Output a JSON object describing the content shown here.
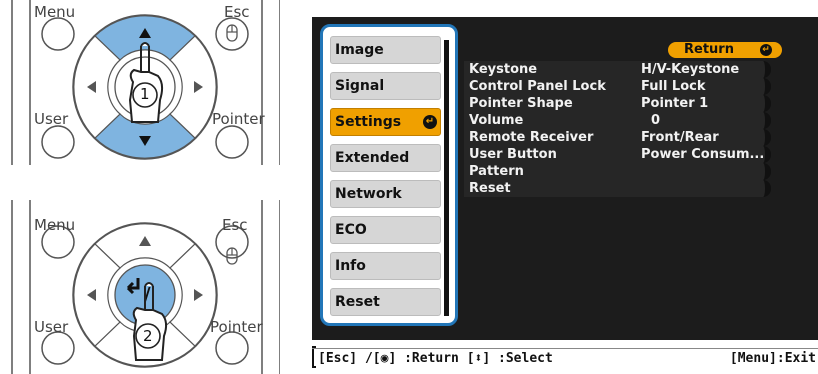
{
  "remote_top": {
    "menu_label": "Menu",
    "esc_label": "Esc",
    "user_label": "User",
    "pointer_label": "Pointer",
    "step": "1"
  },
  "remote_bottom": {
    "menu_label": "Menu",
    "esc_label": "Esc",
    "user_label": "User",
    "pointer_label": "Pointer",
    "step": "2"
  },
  "menu": {
    "items": [
      {
        "label": "Image"
      },
      {
        "label": "Signal"
      },
      {
        "label": "Settings"
      },
      {
        "label": "Extended"
      },
      {
        "label": "Network"
      },
      {
        "label": "ECO"
      },
      {
        "label": "Info"
      },
      {
        "label": "Reset"
      }
    ],
    "selected": "Settings",
    "return_label": "Return",
    "settings": [
      {
        "name": "Keystone",
        "value": "H/V-Keystone"
      },
      {
        "name": "Control Panel Lock",
        "value": "Full Lock"
      },
      {
        "name": "Pointer Shape",
        "value": "Pointer 1"
      },
      {
        "name": "Volume",
        "value": "0"
      },
      {
        "name": "Remote Receiver",
        "value": "Front/Rear"
      },
      {
        "name": "User Button",
        "value": "Power Consum..."
      },
      {
        "name": "Pattern",
        "value": ""
      },
      {
        "name": "Reset",
        "value": ""
      }
    ]
  },
  "status_bar": {
    "left": "[Esc] /[◉] :Return  [⬍] :Select",
    "right": "[Menu]:Exit"
  },
  "colors": {
    "accent_blue": "#2276b8",
    "highlight_orange": "#f0a000",
    "menu_background": "#1c1c1c",
    "arrow_highlight": "#7fb4e0"
  },
  "icons": [
    "up-arrow-icon",
    "down-arrow-icon",
    "left-arrow-icon",
    "right-arrow-icon",
    "enter-icon",
    "mouse-icon",
    "pointing-hand-icon"
  ]
}
